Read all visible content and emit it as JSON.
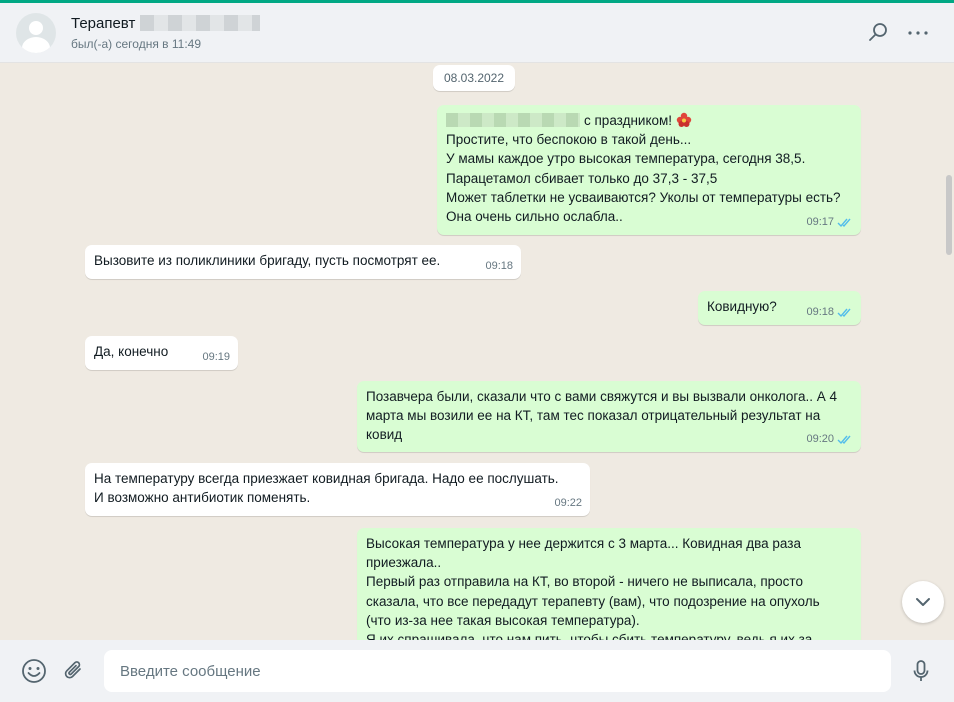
{
  "header": {
    "contact_name": "Терапевт",
    "status": "был(-а) сегодня в 11:49"
  },
  "chat": {
    "date_label": "08.03.2022",
    "messages": [
      {
        "direction": "out",
        "lines": [
          "с праздником!",
          "Простите, что беспокою в такой день...",
          "У мамы каждое утро  высокая температура, сегодня 38,5.",
          "Парацетамол сбивает только до 37,3 - 37,5",
          "Может таблетки не усваиваются? Уколы от температуры есть?",
          "Она очень сильно ослабла.."
        ],
        "time": "09:17",
        "status": "read"
      },
      {
        "direction": "in",
        "lines": [
          "Вызовите из поликлиники бригаду, пусть посмотрят ее."
        ],
        "time": "09:18"
      },
      {
        "direction": "out",
        "lines": [
          "Ковидную?"
        ],
        "time": "09:18",
        "status": "read"
      },
      {
        "direction": "in",
        "lines": [
          "Да, конечно"
        ],
        "time": "09:19"
      },
      {
        "direction": "out",
        "lines": [
          "Позавчера были, сказали что с вами свяжутся и вы вызвали онколога.. А 4",
          "марта мы возили ее на КТ, там тес показал отрицательный результат на",
          "ковид"
        ],
        "time": "09:20",
        "status": "read"
      },
      {
        "direction": "in",
        "lines": [
          "На температуру всегда приезжает ковидная бригада. Надо ее послушать.",
          "И возможно антибиотик поменять."
        ],
        "time": "09:22"
      },
      {
        "direction": "out",
        "lines": [
          "Высокая температура у нее держится с 3 марта... Ковидная два раза",
          "приезжала..",
          "Первый раз отправила на КТ, во второй - ничего не выписала, просто",
          "сказала, что все передадут терапевту (вам), что подозрение на опухоль",
          "(что из-за нее такая высокая температура).",
          "Я их спрашивала, что нам пить, чтобы сбить температуру, ведь я их за"
        ]
      }
    ]
  },
  "composer": {
    "placeholder": "Введите сообщение"
  },
  "colors": {
    "accent": "#00a884",
    "outgoing_bubble": "#d9fdd3",
    "incoming_bubble": "#ffffff",
    "read_ticks": "#53bdeb",
    "chat_background": "#efeae2"
  },
  "icons": [
    "avatar-placeholder",
    "search-icon",
    "menu-icon",
    "flower-emoji-icon",
    "read-ticks-icon",
    "chevron-down-icon",
    "emoji-icon",
    "paperclip-icon",
    "microphone-icon"
  ]
}
